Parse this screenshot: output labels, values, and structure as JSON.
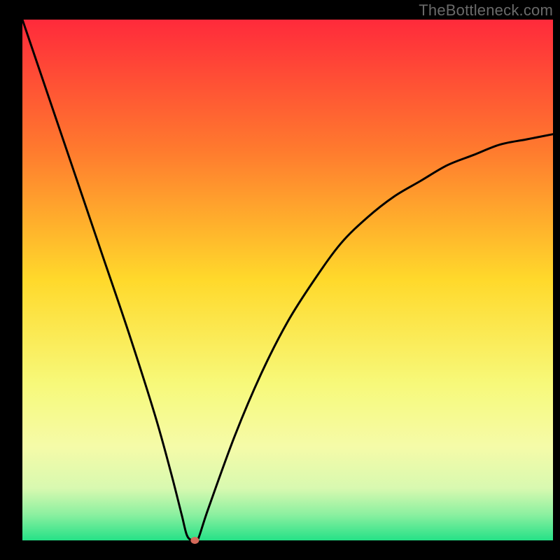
{
  "watermark": "TheBottleneck.com",
  "chart_data": {
    "type": "line",
    "title": "",
    "xlabel": "",
    "ylabel": "",
    "xlim": [
      0,
      100
    ],
    "ylim": [
      0,
      100
    ],
    "grid": false,
    "plot_background": "rainbow-gradient",
    "gradient_stops": [
      {
        "offset": 0.0,
        "color": "#ff2a3b"
      },
      {
        "offset": 0.25,
        "color": "#ff7a2e"
      },
      {
        "offset": 0.5,
        "color": "#ffd92b"
      },
      {
        "offset": 0.7,
        "color": "#f7f97a"
      },
      {
        "offset": 0.82,
        "color": "#f5fba8"
      },
      {
        "offset": 0.9,
        "color": "#d8f9b0"
      },
      {
        "offset": 0.95,
        "color": "#8cf0a0"
      },
      {
        "offset": 1.0,
        "color": "#25e187"
      }
    ],
    "series": [
      {
        "name": "bottleneck-curve",
        "color": "#000000",
        "x": [
          0,
          5,
          10,
          15,
          20,
          25,
          28,
          30,
          31,
          32,
          33,
          35,
          40,
          45,
          50,
          55,
          60,
          65,
          70,
          75,
          80,
          85,
          90,
          95,
          100
        ],
        "values": [
          100,
          85,
          70,
          55,
          40,
          24,
          13,
          5,
          1,
          0,
          0,
          6,
          20,
          32,
          42,
          50,
          57,
          62,
          66,
          69,
          72,
          74,
          76,
          77,
          78
        ]
      }
    ],
    "marker": {
      "name": "optimal-point",
      "x": 32.5,
      "y": 0,
      "color": "#d66a5a",
      "rx": 6,
      "ry": 5
    }
  }
}
